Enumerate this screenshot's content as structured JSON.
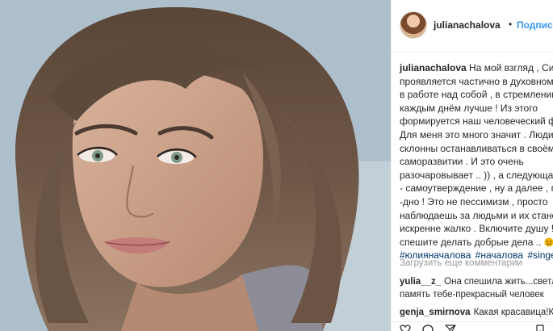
{
  "post": {
    "username": "julianachalova",
    "separator": "•",
    "follow_label": "Подписаться"
  },
  "caption": {
    "username": "julianachalova",
    "lines": [
      "На мой взгляд , Сила",
      "проявляется частично в духовном",
      "в работе над собой , в стремлении",
      "каждым днём лучше ! Из этого",
      "формируется наш человеческий ф",
      "Для меня это много значит . Люди",
      "склонны останавливаться в своём",
      "саморазвитии . И это очень",
      "разочаровывает .. )) , а следующая",
      "- самоутверждение , ну а далее , гр",
      "-дно ! Это не пессимизм , просто",
      "наблюдаешь за людьми и их стано",
      "искренне жалко . Включите душу !",
      "спешите делать добрые дела .."
    ],
    "hashtags": [
      "#юлияначалова",
      "#началова",
      "#singer"
    ]
  },
  "load_more_label": "Загрузить еще комментарии",
  "comments": [
    {
      "user": "yulia__z_",
      "text": "Она спешила жить...светл",
      "text2": "память тебе-прекрасный человек"
    },
    {
      "user": "genja_smirnova",
      "text": "Какая красавица!Ка"
    }
  ],
  "icons": {
    "emoji": "smiling-emoji-icon",
    "like": "heart-icon",
    "comment": "comment-icon",
    "share": "share-icon",
    "save": "bookmark-icon"
  },
  "colors": {
    "link": "#3897f0",
    "hashtag": "#003569",
    "muted": "#999999",
    "emoji": "#f5b400"
  }
}
